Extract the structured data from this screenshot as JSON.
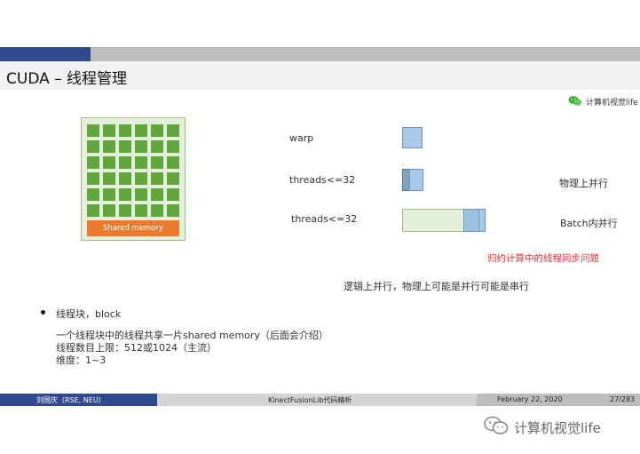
{
  "slide": {
    "title": "CUDA – 线程管理",
    "brand_top": "计算机视觉life"
  },
  "diagram": {
    "shared_memory_label": "Shared memory",
    "labels": {
      "warp": "warp",
      "threads1": "threads<=32",
      "threads2": "threads<=32",
      "physical_parallel": "物理上并行",
      "batch_parallel": "Batch内并行",
      "reduction_note": "归约计算中的线程同步问题",
      "logical_note": "逻辑上并行，物理上可能是并行可能是串行"
    }
  },
  "bullet": {
    "title": "线程块，block",
    "lines": [
      "一个线程块中的线程共享一片shared memory（后面会介绍）",
      "线程数目上限：512或1024（主流）",
      "维度：1~3"
    ]
  },
  "footer": {
    "author": "刘国庆（RSE, NEU）",
    "center": "KinectFusionLib代码精析",
    "date": "February 22, 2020",
    "page": "27/283"
  },
  "watermark": {
    "text": "计算机视觉life"
  },
  "colors": {
    "accent_blue": "#2f4a8f",
    "cell_green": "#62a53d",
    "shared_orange": "#ea7a2e",
    "note_red": "#e53030"
  }
}
